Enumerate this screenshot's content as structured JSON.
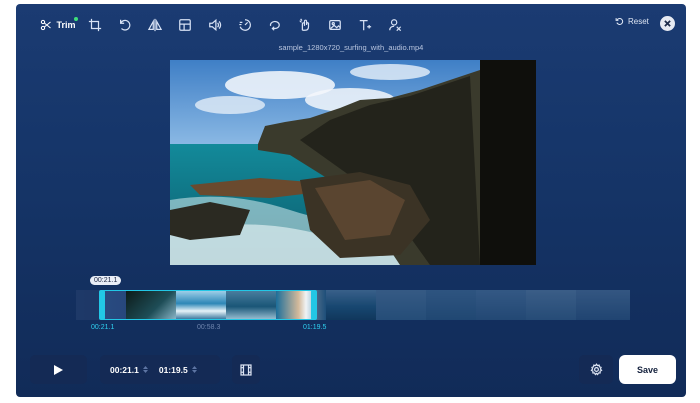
{
  "toolbar": {
    "trim_label": "Trim",
    "tools": [
      "scissors-icon",
      "crop-icon",
      "rotate-icon",
      "flip-icon",
      "split-layout-icon",
      "volume-icon",
      "speed-icon",
      "loop-icon",
      "gesture-icon",
      "image-icon",
      "text-icon",
      "watermark-remove-icon"
    ],
    "reset_label": "Reset"
  },
  "video": {
    "filename": "sample_1280x720_surfing_with_audio.mp4"
  },
  "timeline": {
    "playhead_time": "00:21.1",
    "start_label": "00:21.1",
    "mid_label": "00:58.3",
    "end_label": "01:19.5",
    "selection_start_fraction": 0.047,
    "selection_end_fraction": 0.43
  },
  "controls": {
    "start_time": "00:21.1",
    "end_time": "01:19.5",
    "save_label": "Save"
  },
  "colors": {
    "accent": "#22c7e6",
    "background": "#16366a",
    "panel": "#142a55"
  }
}
